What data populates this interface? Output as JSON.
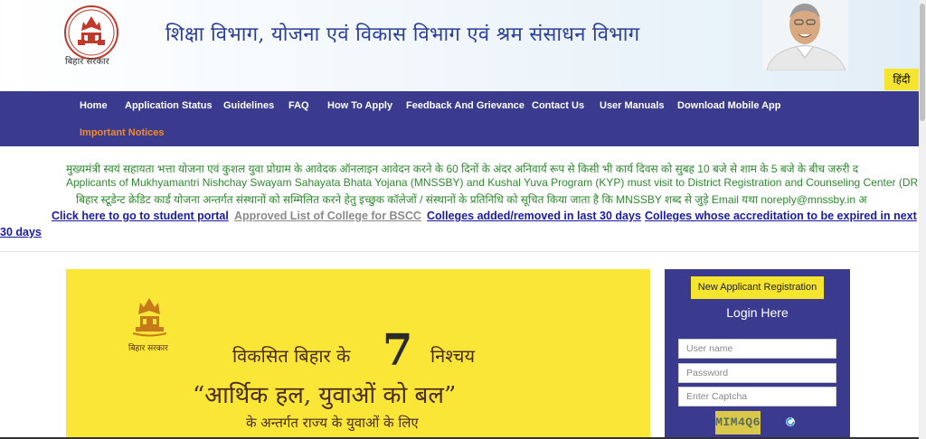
{
  "header": {
    "logo_caption": "बिहार सरकार",
    "title": "शिक्षा विभाग, योजना एवं विकास विभाग एवं श्रम संसाधन विभाग",
    "lang_button": "हिंदी"
  },
  "nav": {
    "items": [
      "Home",
      "Application Status",
      "Guidelines",
      "FAQ",
      "How To Apply",
      "Feedback And Grievance",
      "Contact Us",
      "User Manuals",
      "Download Mobile App"
    ],
    "important": "Important Notices",
    "important_color": "#f28a2b",
    "bg_color": "#3a3a8f"
  },
  "marquees": [
    "मुख्यमंत्री स्वयं सहायता भत्ता योजना एवं कुशल युवा प्रोग्राम के आवेदक ऑनलाइन आवेदन करने के 60 दिनों के अंदर अनिवार्य रूप से किसी भी कार्य दिवस को सुबह 10 बजे से शाम के 5 बजे के बीच जरुरी द",
    "Applicants of Mukhyamantri Nishchay Swayam Sahayata Bhata Yojana (MNSSBY) and Kushal Yuva Program (KYP) must visit to District Registration and Counseling Center (DR",
    "बिहार स्टूडेन्ट क्रेडिट कार्ड योजना अन्तर्गत संस्थानों को सम्मिलित करने हेतु इच्छुक कॉलेजों / संस्थानों के प्रतिनिधि को सूचित किया जाता है कि MNSSBY शब्द से जुड़े Email यथा noreply@mnssby.in अ"
  ],
  "quick_links": {
    "student_portal": "Click here to go to student portal",
    "approved_list": "Approved List of College for BSCC",
    "colleges_added": "Colleges added/removed in last 30 days",
    "accreditation_prefix": "Colleges whose accreditation to be expired in next",
    "accreditation_suffix": "30 days"
  },
  "banner": {
    "emblem_caption": "बिहार सरकार",
    "line1": "विकसित बिहार के",
    "seven": "7",
    "line1_end": "निश्चय",
    "slogan": "“आर्थिक हल, युवाओं को बल”",
    "subtitle": "के अन्तर्गत राज्य के युवाओं के लिए",
    "bg_color": "#f9e637"
  },
  "login": {
    "new_registration": "New Applicant Registration",
    "title": "Login Here",
    "username_placeholder": "User name",
    "password_placeholder": "Password",
    "captcha_placeholder": "Enter Captcha",
    "captcha_text": "MIM4Q6"
  }
}
